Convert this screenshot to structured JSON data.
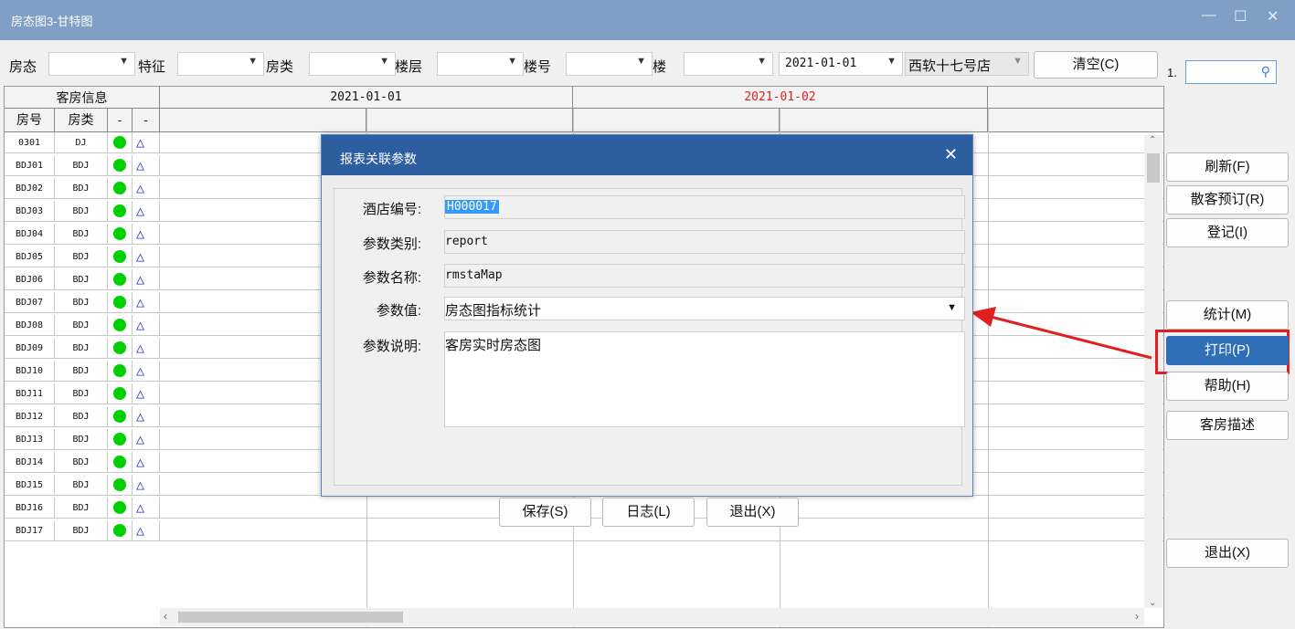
{
  "window": {
    "title": "房态图3-甘特图",
    "minimize": "—",
    "maximize": "☐",
    "close": "✕"
  },
  "filters": {
    "fang_tai": "房态",
    "te_zheng": "特征",
    "fang_lei": "房类",
    "lou_ceng": "楼层",
    "lou_hao": "楼号",
    "lou": "楼",
    "date": "2021-01-01",
    "hotel": "西软十七号店",
    "clear_button": "清空(C)",
    "page_label": "1."
  },
  "grid": {
    "group_header": "客房信息",
    "col_room_no": "房号",
    "col_room_type": "房类",
    "col_a": "-",
    "col_b": "-",
    "date1": "2021-01-01",
    "date2": "2021-01-02",
    "date2_color": "#e02020",
    "rows": [
      {
        "no": "0301",
        "type": "DJ"
      },
      {
        "no": "BDJ01",
        "type": "BDJ"
      },
      {
        "no": "BDJ02",
        "type": "BDJ"
      },
      {
        "no": "BDJ03",
        "type": "BDJ"
      },
      {
        "no": "BDJ04",
        "type": "BDJ"
      },
      {
        "no": "BDJ05",
        "type": "BDJ"
      },
      {
        "no": "BDJ06",
        "type": "BDJ"
      },
      {
        "no": "BDJ07",
        "type": "BDJ"
      },
      {
        "no": "BDJ08",
        "type": "BDJ"
      },
      {
        "no": "BDJ09",
        "type": "BDJ"
      },
      {
        "no": "BDJ10",
        "type": "BDJ"
      },
      {
        "no": "BDJ11",
        "type": "BDJ"
      },
      {
        "no": "BDJ12",
        "type": "BDJ"
      },
      {
        "no": "BDJ13",
        "type": "BDJ"
      },
      {
        "no": "BDJ14",
        "type": "BDJ"
      },
      {
        "no": "BDJ15",
        "type": "BDJ"
      },
      {
        "no": "BDJ16",
        "type": "BDJ"
      },
      {
        "no": "BDJ17",
        "type": "BDJ"
      }
    ]
  },
  "side_buttons": {
    "refresh": "刷新(F)",
    "walkin": "散客预订(R)",
    "checkin": "登记(I)",
    "stats": "统计(M)",
    "print": "打印(P)",
    "help": "帮助(H)",
    "room_desc": "客房描述",
    "exit": "退出(X)"
  },
  "dialog": {
    "title": "报表关联参数",
    "hotel_code_label": "酒店编号:",
    "hotel_code": "H000017",
    "param_type_label": "参数类别:",
    "param_type": "report",
    "param_name_label": "参数名称:",
    "param_name": "rmstaMap",
    "param_value_label": "参数值:",
    "param_value": "房态图指标统计",
    "param_desc_label": "参数说明:",
    "param_desc": "客房实时房态图",
    "save": "保存(S)",
    "log": "日志(L)",
    "exit": "退出(X)"
  },
  "colors": {
    "accent": "#2d5fa0",
    "highlight_box": "#e02020",
    "status_dot": "#00d000"
  }
}
